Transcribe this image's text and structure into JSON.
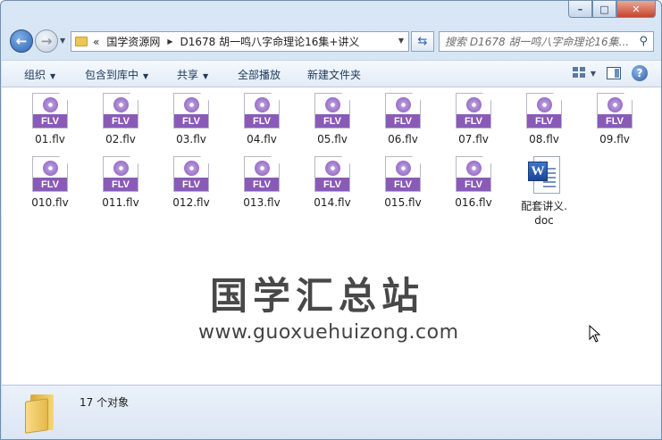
{
  "window": {
    "min_label": "–",
    "max_label": "□",
    "close_label": "✕"
  },
  "nav": {
    "back_label": "←",
    "forward_label": "→",
    "dropdown": "▼",
    "breadcrumb_overflow": "«",
    "breadcrumbs": [
      "国学资源网",
      "D1678 胡一鸣八字命理论16集+讲义"
    ],
    "refresh_label": "⇆",
    "search_placeholder": "搜索 D1678 胡一鸣八字命理论16集..."
  },
  "toolbar": {
    "organize": "组织",
    "include_library": "包含到库中",
    "share": "共享",
    "play_all": "全部播放",
    "new_folder": "新建文件夹",
    "help": "?"
  },
  "files": [
    {
      "name": "01.flv",
      "type": "flv"
    },
    {
      "name": "02.flv",
      "type": "flv"
    },
    {
      "name": "03.flv",
      "type": "flv"
    },
    {
      "name": "04.flv",
      "type": "flv"
    },
    {
      "name": "05.flv",
      "type": "flv"
    },
    {
      "name": "06.flv",
      "type": "flv"
    },
    {
      "name": "07.flv",
      "type": "flv"
    },
    {
      "name": "08.flv",
      "type": "flv"
    },
    {
      "name": "09.flv",
      "type": "flv"
    },
    {
      "name": "010.flv",
      "type": "flv"
    },
    {
      "name": "011.flv",
      "type": "flv"
    },
    {
      "name": "012.flv",
      "type": "flv"
    },
    {
      "name": "013.flv",
      "type": "flv"
    },
    {
      "name": "014.flv",
      "type": "flv"
    },
    {
      "name": "015.flv",
      "type": "flv"
    },
    {
      "name": "016.flv",
      "type": "flv"
    },
    {
      "name": "配套讲义.doc",
      "type": "doc"
    }
  ],
  "flv_badge": "FLV",
  "doc_badge": "W",
  "watermark": {
    "cn": "国学汇总站",
    "url": "www.guoxuehuizong.com"
  },
  "status": {
    "count": "17 个对象"
  }
}
